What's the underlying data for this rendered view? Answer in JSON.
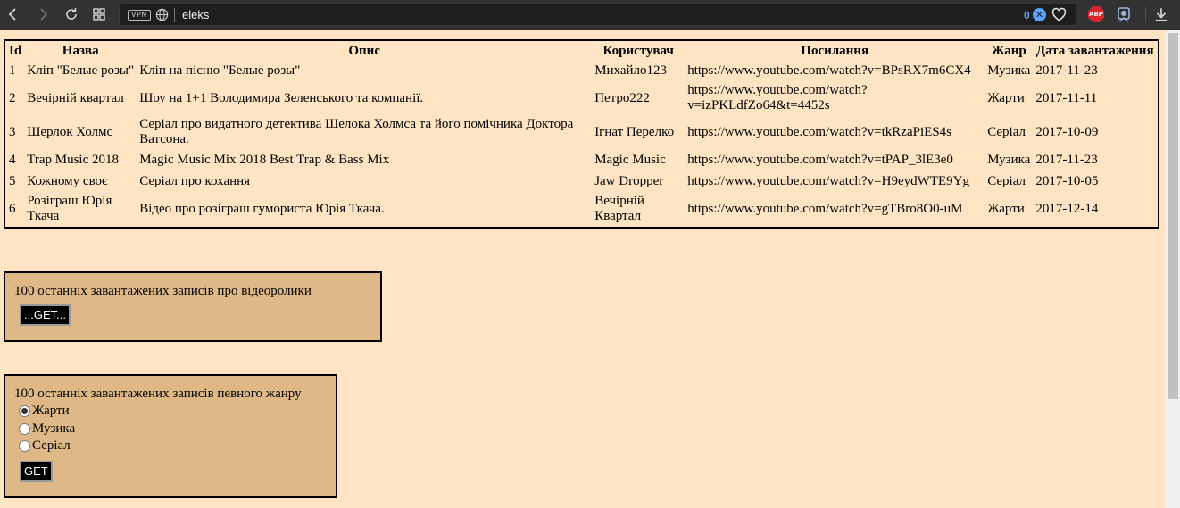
{
  "browser": {
    "vpn_label": "VPN",
    "url": "eleks",
    "blocked_count": "0"
  },
  "table": {
    "headers": [
      "Id",
      "Назва",
      "Опис",
      "Користувач",
      "Посилання",
      "Жанр",
      "Дата завантаження"
    ],
    "rows": [
      [
        "1",
        "Кліп \"Белые розы\"",
        "Кліп на пісню \"Белые розы\"",
        "Михайло123",
        "https://www.youtube.com/watch?v=BPsRX7m6CX4",
        "Музика",
        "2017-11-23"
      ],
      [
        "2",
        "Вечірній квартал",
        "Шоу на 1+1 Володимира Зеленського та компанії.",
        "Петро222",
        "https://www.youtube.com/watch?v=izPKLdfZo64&t=4452s",
        "Жарти",
        "2017-11-11"
      ],
      [
        "3",
        "Шерлок Холмс",
        "Серіал про видатного детектива Шелока Холмса та його помічника Доктора Ватсона.",
        "Ігнат Перелко",
        "https://www.youtube.com/watch?v=tkRzaPiES4s",
        "Серіал",
        "2017-10-09"
      ],
      [
        "4",
        "Trap Music 2018",
        "Magic Music Mix 2018 Best Trap & Bass Mix",
        "Magic Music",
        "https://www.youtube.com/watch?v=tPAP_3lE3e0",
        "Музика",
        "2017-11-23"
      ],
      [
        "5",
        "Кожному своє",
        "Серіал про кохання",
        "Jaw Dropper",
        "https://www.youtube.com/watch?v=H9eydWTE9Yg",
        "Серіал",
        "2017-10-05"
      ],
      [
        "6",
        "Розіграш Юрія Ткача",
        "Відео про розіграш гумориста Юрія Ткача.",
        "Вечірній Квартал",
        "https://www.youtube.com/watch?v=gTBro8O0-uM",
        "Жарти",
        "2017-12-14"
      ]
    ]
  },
  "latest_panel": {
    "title": "100 останніх завантажених записів про відеоролики",
    "button": "...GET..."
  },
  "genre_panel": {
    "title": "100 останніх завантажених записів певного жанру",
    "options": [
      {
        "label": "Жарти",
        "checked": true
      },
      {
        "label": "Музика",
        "checked": false
      },
      {
        "label": "Серіал",
        "checked": false
      }
    ],
    "button": "GET"
  }
}
